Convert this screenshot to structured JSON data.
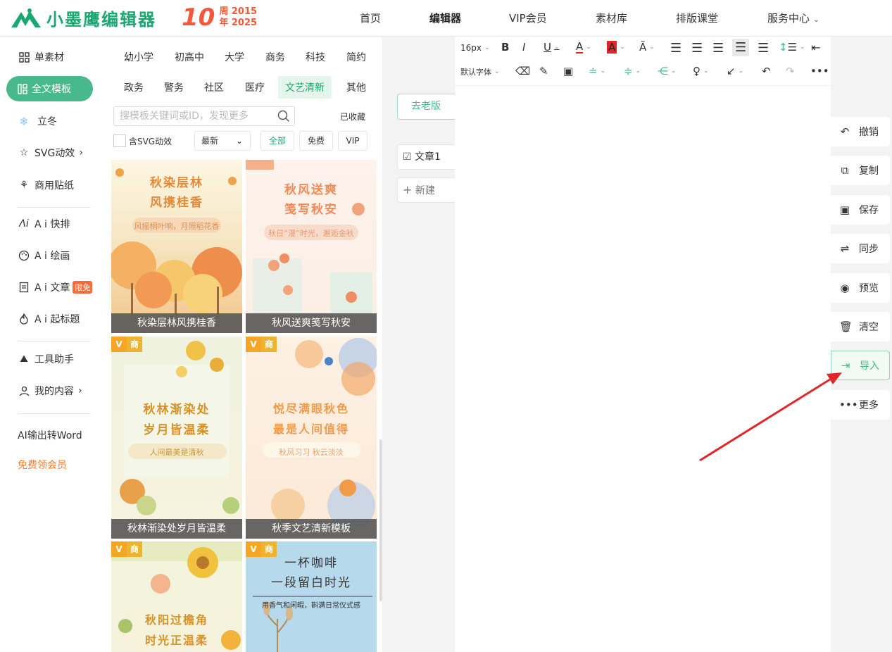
{
  "header": {
    "logo_text": "小墨鹰编辑器",
    "anniv_num": "10",
    "anniv_line1": "周 2015",
    "anniv_line2": "年 2025",
    "nav": [
      "首页",
      "编辑器",
      "VIP会员",
      "素材库",
      "排版课堂",
      "服务中心"
    ],
    "nav_active": "编辑器"
  },
  "sidebar": {
    "items": [
      {
        "label": "单素材",
        "icon": "grid-icon"
      },
      {
        "label": "全文模板",
        "icon": "template-icon"
      },
      {
        "label": "立冬",
        "icon": "snowflake-icon"
      },
      {
        "label": "SVG动效",
        "icon": "star-icon"
      },
      {
        "label": "商用贴纸",
        "icon": "puzzle-icon"
      },
      {
        "label": "A i 快排",
        "icon": "ai-icon"
      },
      {
        "label": "A i 绘画",
        "icon": "palette-icon"
      },
      {
        "label": "A i 文章",
        "icon": "doc-icon"
      },
      {
        "label": "A i 起标题",
        "icon": "fire-icon"
      },
      {
        "label": "工具助手",
        "icon": "tools-icon"
      },
      {
        "label": "我的内容",
        "icon": "user-icon"
      },
      {
        "label": "AI输出转Word",
        "icon": ""
      },
      {
        "label": "免费领会员",
        "icon": ""
      }
    ],
    "badge": "限免",
    "active_color": "#47b98b"
  },
  "templates": {
    "categories_row1": [
      "幼小学",
      "初高中",
      "大学",
      "商务",
      "科技",
      "简约"
    ],
    "categories_row2": [
      "政务",
      "警务",
      "社区",
      "医疗",
      "文艺清新",
      "其他"
    ],
    "active_category": "文艺清新",
    "search_placeholder": "搜模板关键词或ID，发现更多",
    "collected": "已收藏",
    "svg_check_label": "含SVG动效",
    "sort": "最新",
    "filters": [
      "全部",
      "免费",
      "VIP"
    ],
    "tag_v": "V",
    "tag_biz": "商",
    "cards": [
      {
        "caption": "秋染层林风携桂香",
        "t1": "秋染层林",
        "t2": "风携桂香",
        "sub": "风摇桐叶响，月照稻花香"
      },
      {
        "caption": "秋风送爽笺写秋安",
        "t1": "秋风送爽",
        "t2": "笺写秋安",
        "sub": "秋日“漫”时光，邂逅金秋"
      },
      {
        "caption": "秋林渐染处岁月皆温柔",
        "t1": "秋林渐染处",
        "t2": "岁月皆温柔",
        "sub": "人间最美是清秋"
      },
      {
        "caption": "秋季文艺清新模板",
        "t1": "悦尽满眼秋色",
        "t2": "最是人间值得",
        "sub": "秋风习习 秋云淡淡"
      },
      {
        "caption": "",
        "t1": "秋阳过檐角",
        "t2": "时光正温柔",
        "sub": ""
      },
      {
        "caption": "",
        "t1": "一杯咖啡",
        "t2": "一段留白时光",
        "sub": "用香气和闲暇，斟满日常仪式感"
      }
    ]
  },
  "middle": {
    "old_version": "去老版",
    "article": "文章1",
    "new": "新建"
  },
  "toolbar": {
    "font_size": "16px",
    "font_family": "默认字体"
  },
  "right_actions": [
    {
      "label": "撤销",
      "icon": "undo-icon"
    },
    {
      "label": "复制",
      "icon": "copy-icon"
    },
    {
      "label": "保存",
      "icon": "save-icon"
    },
    {
      "label": "同步",
      "icon": "sync-icon"
    },
    {
      "label": "预览",
      "icon": "eye-icon"
    },
    {
      "label": "清空",
      "icon": "trash-icon"
    },
    {
      "label": "导入",
      "icon": "import-icon"
    },
    {
      "label": "更多",
      "icon": "more-icon"
    }
  ],
  "accent_color": "#1aa772",
  "arrow_color": "#e0262a"
}
